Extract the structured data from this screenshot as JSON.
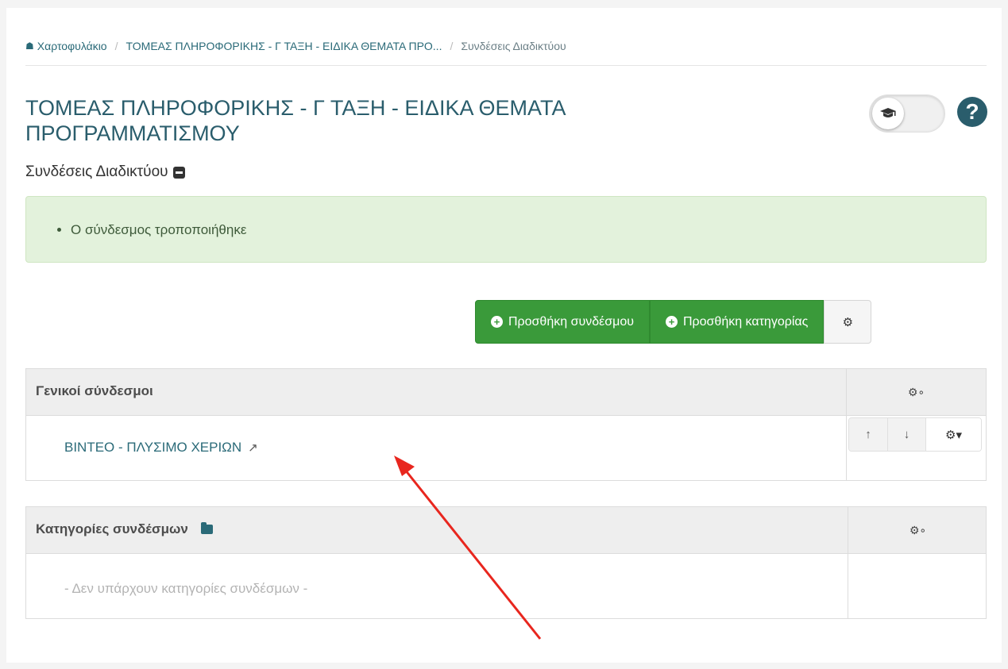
{
  "breadcrumb": {
    "home": "Χαρτοφυλάκιο",
    "course": "ΤΟΜΕΑΣ ΠΛΗΡΟΦΟΡΙΚΗΣ - Γ ΤΑΞΗ - ΕΙΔΙΚΑ ΘΕΜΑΤΑ ΠΡΟ...",
    "current": "Συνδέσεις Διαδικτύου"
  },
  "page": {
    "title": "ΤΟΜΕΑΣ ΠΛΗΡΟΦΟΡΙΚΗΣ - Γ ΤΑΞΗ - ΕΙΔΙΚΑ ΘΕΜΑΤΑ ΠΡΟΓΡΑΜΜΑΤΙΣΜΟΥ",
    "subtitle": "Συνδέσεις Διαδικτύου"
  },
  "alert": {
    "message": "Ο σύνδεσμος τροποποιήθηκε"
  },
  "toolbar": {
    "add_link": "Προσθήκη συνδέσμου",
    "add_category": "Προσθήκη κατηγορίας"
  },
  "general_links": {
    "header": "Γενικοί σύνδεσμοι",
    "items": [
      {
        "label": "ΒΙΝΤΕΟ - ΠΛΥΣΙΜΟ ΧΕΡΙΩΝ"
      }
    ]
  },
  "categories": {
    "header": "Κατηγορίες συνδέσμων",
    "empty": "- Δεν υπάρχουν κατηγορίες συνδέσμων -"
  },
  "icons": {
    "home": "home-icon",
    "toggle": "graduation-cap-icon",
    "help": "question-circle-icon",
    "collapse": "minus-square-icon",
    "add": "plus-circle-icon",
    "gear": "gear-icon",
    "gears": "gears-icon",
    "up": "arrow-up-icon",
    "down": "arrow-down-icon",
    "external": "external-link-icon",
    "folder": "folder-icon"
  },
  "colors": {
    "accent": "#2a5d6c",
    "success": "#3a9a3a",
    "alert_bg": "#e3f2dc",
    "annotation": "#e8261e"
  }
}
